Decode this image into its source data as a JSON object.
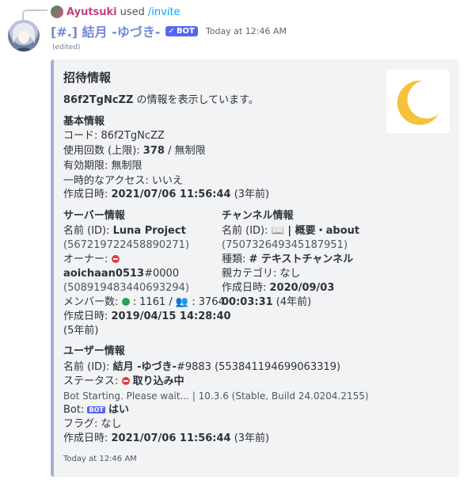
{
  "reply": {
    "user": "Ayutsuki",
    "used": "used",
    "command": "/invite"
  },
  "header": {
    "name": "[#.] 結月 -ゆづき-",
    "badge": "BOT",
    "time": "Today at 12:46 AM",
    "edited": "(edited)"
  },
  "embed": {
    "title": "招待情報",
    "desc": {
      "code": "86f2TgNcZZ",
      "text": " の情報を表示しています。"
    },
    "basic": {
      "name": "基本情報",
      "code": "コード: 86f2TgNcZZ",
      "uses_label": "使用回数 (上限): ",
      "uses_value": "378",
      "uses_rest": " / 無制限",
      "expiry": "有効期限: 無制限",
      "temporary": "一時的なアクセス: いいえ",
      "created_label": "作成日時: ",
      "created_value": "2021/07/06 11:56:44",
      "created_rel": " (3年前)"
    },
    "server": {
      "name": "サーバー情報",
      "name_label": "名前 (ID): ",
      "name_value": "Luna Project",
      "id": "(567219722458890271)",
      "owner_label": "オーナー: ",
      "owner_name": "aoichaan0513",
      "owner_tag": "#0000",
      "owner_id": "(508919483440693294)",
      "members_label": "メンバー数: ",
      "members_online": " : 1161 / ",
      "members_total": " : 3764",
      "created_label": "作成日時: ",
      "created_value": "2019/04/15 14:28:40",
      "created_rel": "(5年前)"
    },
    "channel": {
      "name": "チャンネル情報",
      "name_label": "名前 (ID): ",
      "name_value": " | 概要・about",
      "id": "(750732649345187951)",
      "type_label": "種類: ",
      "type_value": "# テキストチャンネル",
      "category": "親カテゴリ: なし",
      "created_label": "作成日時: ",
      "created_value": "2020/09/03",
      "created_value2": "00:03:31",
      "created_rel": " (4年前)"
    },
    "user": {
      "name": "ユーザー情報",
      "name_label": "名前 (ID): ",
      "name_value": "結月 -ゆづき-",
      "name_tag": "#9883 (553841194699063319)",
      "status_label": "ステータス: ",
      "status_value": "取り込み中",
      "activity": "Bot Starting. Please wait... | 10.3.6 (Stable, Build 24.0204.2155)",
      "bot_label": "Bot: ",
      "bot_badge": "BOT",
      "bot_value": "はい",
      "flags": "フラグ: なし",
      "created_label": "作成日時: ",
      "created_value": "2021/07/06 11:56:44",
      "created_rel": " (3年前)"
    },
    "footer": "Today at 12:46 AM",
    "thumbnail_icon": "crescent-moon-icon"
  },
  "colors": {
    "bot_name": "#7289da",
    "reply_user": "#c2437a",
    "command": "#00a8fc",
    "embed_border": "#a4b0d4",
    "moon": "#f6c13b",
    "blurple": "#5865f2"
  }
}
